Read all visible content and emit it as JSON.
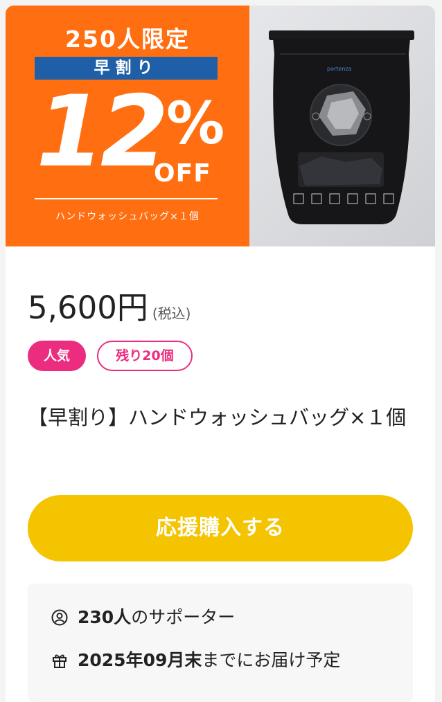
{
  "promo": {
    "limit_text": "250人限定",
    "early_label": "早割り",
    "discount_number": "12",
    "percent_sign": "%",
    "off_text": "OFF",
    "item_text": "ハンドウォッシュバッグ×１個"
  },
  "product_photo": {
    "brand_text": "portenza",
    "icon_count": 6
  },
  "price": {
    "amount": "5,600円",
    "tax_note": "(税込)"
  },
  "tags": {
    "popular": "人気",
    "remaining": "残り20個"
  },
  "reward_title": "【早割り】ハンドウォッシュバッグ×１個",
  "buy_button": {
    "label": "応援購入する"
  },
  "info": {
    "supporters_count": "230人",
    "supporters_suffix": "のサポーター",
    "delivery_date": "2025年09月末",
    "delivery_suffix": "までにお届け予定"
  },
  "colors": {
    "promo_orange": "#ff6f12",
    "promo_blue": "#1f5fa8",
    "tag_pink": "#ec2d7f",
    "button_yellow": "#f5c400"
  },
  "icons": {
    "supporters": "person-circle-icon",
    "delivery": "gift-icon"
  }
}
